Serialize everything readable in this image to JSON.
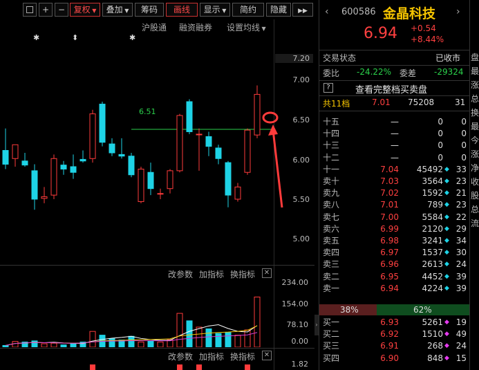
{
  "toolbar": {
    "buttons": [
      {
        "label": "",
        "name": "collapse-button"
      },
      {
        "label": "+",
        "name": "zoom-in-button"
      },
      {
        "label": "−",
        "name": "zoom-out-button"
      },
      {
        "label": "复权",
        "name": "adjust-button"
      },
      {
        "label": "叠加",
        "name": "overlay-button"
      },
      {
        "label": "筹码",
        "name": "chips-button"
      },
      {
        "label": "画线",
        "name": "draw-line-button"
      },
      {
        "label": "显示",
        "name": "display-button"
      },
      {
        "label": "简约",
        "name": "simple-button"
      },
      {
        "label": "隐藏",
        "name": "hide-button"
      }
    ],
    "expand_glyph": "▶▶"
  },
  "links": {
    "hgt": "沪股通",
    "margin": "融资融券",
    "ma_setting": "设置均线"
  },
  "markers": [
    "✱",
    "⬍",
    "✱"
  ],
  "price_axis": [
    "7.20",
    "7.00",
    "6.50",
    "6.00",
    "5.50",
    "5.00"
  ],
  "hline_label": "6.51",
  "vol_panel": {
    "adjust": "改参数",
    "add": "加指标",
    "switch": "换指标",
    "close": "✕",
    "axis": [
      "234.00",
      "154.00",
      "78.10",
      "0.00"
    ]
  },
  "ind_panel": {
    "adjust": "改参数",
    "add": "加指标",
    "switch": "换指标",
    "close": "✕",
    "axis": [
      "1.82"
    ]
  },
  "stock": {
    "code": "600586",
    "name": "金晶科技",
    "price": "6.94",
    "change": "+0.54",
    "pct": "+8.44%",
    "status_label": "交易状态",
    "status_value": "已收市",
    "wb_label": "委比",
    "wb_value": "-24.22%",
    "wc_label": "委差",
    "wc_value": "-29324",
    "q_icon": "?",
    "full_book": "查看完整档买卖盘",
    "levels_label": "共11档",
    "levels_price": "7.01",
    "levels_vol": "75208",
    "levels_count": "31"
  },
  "asks": [
    {
      "label": "十五",
      "price": "—",
      "vol": "0",
      "mark": "",
      "count": "0"
    },
    {
      "label": "十四",
      "price": "—",
      "vol": "0",
      "mark": "",
      "count": "0"
    },
    {
      "label": "十三",
      "price": "—",
      "vol": "0",
      "mark": "",
      "count": "0"
    },
    {
      "label": "十二",
      "price": "—",
      "vol": "0",
      "mark": "",
      "count": "0"
    },
    {
      "label": "十一",
      "price": "7.04",
      "vol": "45492",
      "mark": "◆",
      "count": "33"
    },
    {
      "label": "卖十",
      "price": "7.03",
      "vol": "3564",
      "mark": "◆",
      "count": "23"
    },
    {
      "label": "卖九",
      "price": "7.02",
      "vol": "1592",
      "mark": "◆",
      "count": "21"
    },
    {
      "label": "卖八",
      "price": "7.01",
      "vol": "789",
      "mark": "◆",
      "count": "23"
    },
    {
      "label": "卖七",
      "price": "7.00",
      "vol": "5584",
      "mark": "◆",
      "count": "22"
    },
    {
      "label": "卖六",
      "price": "6.99",
      "vol": "2120",
      "mark": "◆",
      "count": "29"
    },
    {
      "label": "卖五",
      "price": "6.98",
      "vol": "3241",
      "mark": "◆",
      "count": "34"
    },
    {
      "label": "卖四",
      "price": "6.97",
      "vol": "1537",
      "mark": "◆",
      "count": "30"
    },
    {
      "label": "卖三",
      "price": "6.96",
      "vol": "2613",
      "mark": "◆",
      "count": "24"
    },
    {
      "label": "卖二",
      "price": "6.95",
      "vol": "4452",
      "mark": "◆",
      "count": "39"
    },
    {
      "label": "卖一",
      "price": "6.94",
      "vol": "4224",
      "mark": "◆",
      "count": "39"
    }
  ],
  "ratio": {
    "buy": "38%",
    "sell": "62%"
  },
  "bids": [
    {
      "label": "买一",
      "price": "6.93",
      "vol": "5261",
      "mark": "◆",
      "count": "19"
    },
    {
      "label": "买二",
      "price": "6.92",
      "vol": "1510",
      "mark": "◆",
      "count": "49"
    },
    {
      "label": "买三",
      "price": "6.91",
      "vol": "268",
      "mark": "◆",
      "count": "24"
    },
    {
      "label": "买四",
      "price": "6.90",
      "vol": "848",
      "mark": "◆",
      "count": "15"
    }
  ],
  "sidebar_text": [
    "盘",
    "最",
    "涨",
    "总",
    "换",
    "最",
    "今",
    "涨",
    "净",
    "收",
    "股",
    "总",
    "流"
  ],
  "colors": {
    "up": "#ff3b3b",
    "down": "#1ed3e6",
    "bg": "#000000",
    "accent": "#ff4040"
  },
  "chart_data": {
    "type": "candlestick",
    "ylim": [
      4.85,
      7.25
    ],
    "candles": [
      {
        "o": 6.25,
        "h": 6.52,
        "l": 6.02,
        "c": 6.08
      },
      {
        "o": 6.15,
        "h": 6.3,
        "l": 6.05,
        "c": 6.32
      },
      {
        "o": 6.12,
        "h": 6.22,
        "l": 6.05,
        "c": 6.07
      },
      {
        "o": 6.0,
        "h": 6.08,
        "l": 5.52,
        "c": 5.65
      },
      {
        "o": 5.66,
        "h": 5.8,
        "l": 5.6,
        "c": 5.68
      },
      {
        "o": 5.7,
        "h": 6.2,
        "l": 5.65,
        "c": 6.15
      },
      {
        "o": 6.07,
        "h": 6.12,
        "l": 5.95,
        "c": 6.02
      },
      {
        "o": 6.05,
        "h": 6.2,
        "l": 5.9,
        "c": 5.98
      },
      {
        "o": 6.14,
        "h": 6.25,
        "l": 6.1,
        "c": 6.12
      },
      {
        "o": 6.15,
        "h": 6.75,
        "l": 6.1,
        "c": 6.7
      },
      {
        "o": 6.82,
        "h": 6.85,
        "l": 6.3,
        "c": 6.35
      },
      {
        "o": 6.33,
        "h": 6.4,
        "l": 6.18,
        "c": 6.22
      },
      {
        "o": 6.2,
        "h": 6.4,
        "l": 6.15,
        "c": 6.18
      },
      {
        "o": 6.18,
        "h": 6.22,
        "l": 5.92,
        "c": 5.95
      },
      {
        "o": 5.62,
        "h": 6.05,
        "l": 5.6,
        "c": 6.02
      },
      {
        "o": 5.98,
        "h": 6.1,
        "l": 5.7,
        "c": 5.78
      },
      {
        "o": 5.72,
        "h": 5.78,
        "l": 5.65,
        "c": 5.72
      },
      {
        "o": 5.78,
        "h": 6.02,
        "l": 5.72,
        "c": 6.0
      },
      {
        "o": 6.0,
        "h": 6.7,
        "l": 5.98,
        "c": 6.68
      },
      {
        "o": 6.85,
        "h": 6.88,
        "l": 6.45,
        "c": 6.48
      },
      {
        "o": 6.45,
        "h": 6.52,
        "l": 6.0,
        "c": 6.45
      },
      {
        "o": 6.42,
        "h": 6.48,
        "l": 6.18,
        "c": 6.3
      },
      {
        "o": 6.28,
        "h": 6.32,
        "l": 6.08,
        "c": 6.15
      },
      {
        "o": 6.1,
        "h": 6.12,
        "l": 5.55,
        "c": 5.7
      },
      {
        "o": 5.65,
        "h": 5.85,
        "l": 5.62,
        "c": 5.8
      },
      {
        "o": 5.98,
        "h": 6.52,
        "l": 5.95,
        "c": 6.5
      },
      {
        "o": 6.44,
        "h": 7.05,
        "l": 6.4,
        "c": 6.94
      }
    ],
    "volume": [
      6,
      20,
      18,
      22,
      12,
      14,
      8,
      12,
      18,
      55,
      42,
      30,
      25,
      38,
      18,
      22,
      18,
      26,
      118,
      92,
      70,
      64,
      48,
      52,
      42,
      60,
      175
    ],
    "vol_ylim": [
      0,
      234
    ],
    "hline": 6.51
  }
}
